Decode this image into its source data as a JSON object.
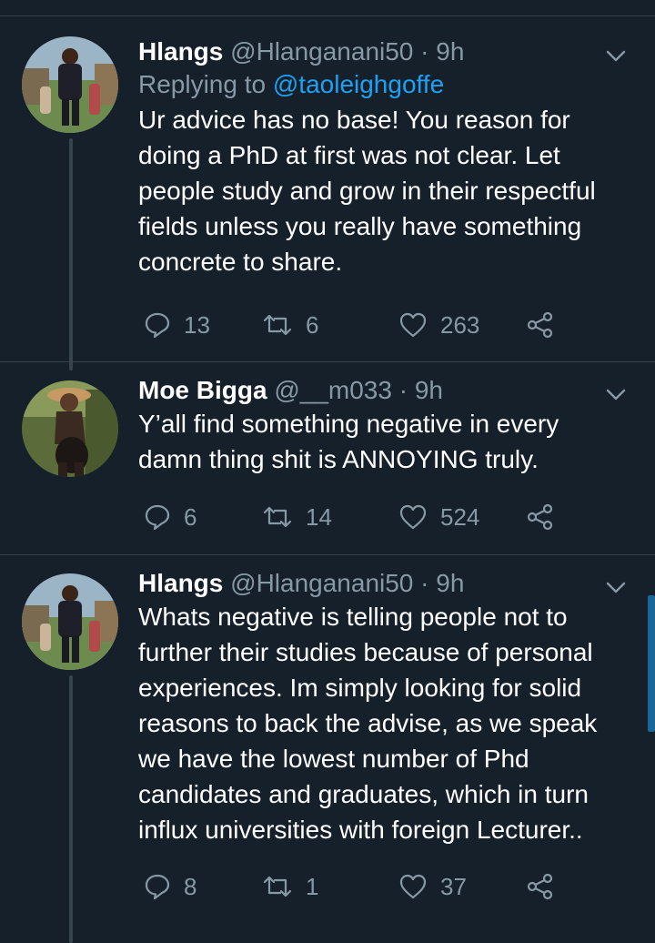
{
  "tweets": [
    {
      "name": "Hlangs",
      "handle": "@Hlanganani50",
      "separator": "·",
      "time": "9h",
      "reply_prefix": "Replying to",
      "reply_to": "@taoleighgoffe",
      "text": "Ur advice has no base! You reason for doing a PhD at first was not clear. Let people study and grow in their respectful fields unless you really have something concrete to share.",
      "replies": "13",
      "retweets": "6",
      "likes": "263"
    },
    {
      "name": "Moe Bigga",
      "handle": "@__m033",
      "separator": "·",
      "time": "9h",
      "text": "Y’all find something negative in every damn thing shit is ANNOYING truly.",
      "replies": "6",
      "retweets": "14",
      "likes": "524"
    },
    {
      "name": "Hlangs",
      "handle": "@Hlanganani50",
      "separator": "·",
      "time": "9h",
      "text": "Whats negative is telling people not to further their studies because of personal experiences. Im simply looking for solid reasons to back the advise, as we speak we have the lowest number of Phd candidates and graduates, which in turn influx universities with foreign Lecturer..",
      "replies": "8",
      "retweets": "1",
      "likes": "37"
    }
  ],
  "icons": {
    "reply": "reply-icon",
    "retweet": "retweet-icon",
    "like": "heart-icon",
    "share": "share-icon",
    "more": "chevron-down-icon"
  },
  "colors": {
    "background": "#15202b",
    "text": "#ffffff",
    "muted": "#8899a6",
    "accent": "#1da1f2",
    "divider": "#38444d"
  }
}
